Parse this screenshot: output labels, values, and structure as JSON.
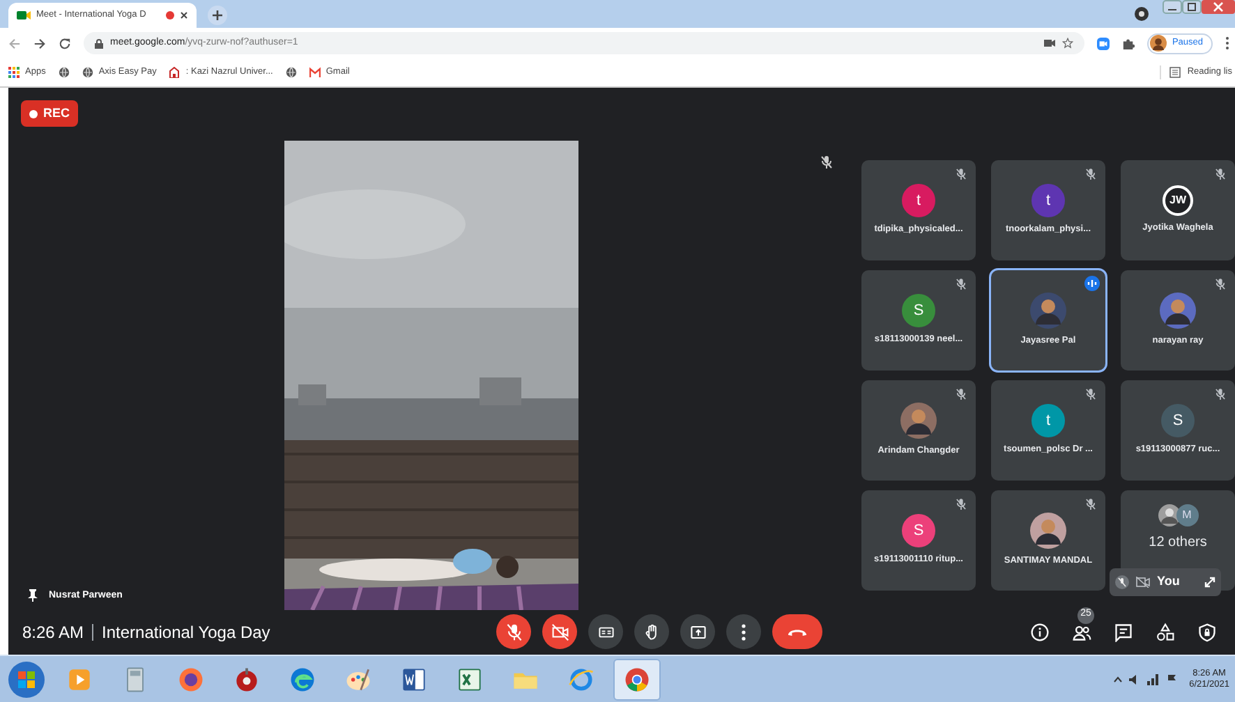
{
  "browser": {
    "tab": {
      "title": "Meet - International Yoga D",
      "recording": true,
      "selected": true
    },
    "url_host": "meet.google.com",
    "url_path": "/yvq-zurw-nof?authuser=1",
    "profile": "Paused",
    "bookmarks": [
      {
        "kind": "apps",
        "label": "Apps"
      },
      {
        "kind": "globe"
      },
      {
        "kind": "globe",
        "label": "Axis Easy Pay"
      },
      {
        "kind": "uni",
        "label": ": Kazi Nazrul Univer..."
      },
      {
        "kind": "globe"
      },
      {
        "kind": "gmail",
        "label": "Gmail"
      }
    ],
    "reading_list": "Reading lis"
  },
  "meet": {
    "rec": "REC",
    "presenter": "Nusrat Parween",
    "presenter_muted": true,
    "tiles": [
      {
        "kind": "letter",
        "name": "tdipika_physicaled...",
        "initial": "t",
        "color": "#d81b60",
        "muted": true,
        "speaking": false
      },
      {
        "kind": "letter",
        "name": "tnoorkalam_physi...",
        "initial": "t",
        "color": "#5e35b1",
        "muted": true,
        "speaking": false
      },
      {
        "kind": "outlined",
        "name": "Jyotika Waghela",
        "initial": "JW",
        "color": "#202124",
        "muted": true,
        "speaking": false
      },
      {
        "kind": "letter",
        "name": "s18113000139 neel...",
        "initial": "S",
        "color": "#388e3c",
        "muted": true,
        "speaking": false
      },
      {
        "name": "Jayasree Pal",
        "color": "#3c4a6e",
        "muted": false,
        "speaking": true
      },
      {
        "name": "narayan ray",
        "color": "#5c6bc0",
        "muted": true,
        "speaking": false
      },
      {
        "name": "Arindam Changder",
        "color": "#8d6e63",
        "muted": true,
        "speaking": false
      },
      {
        "kind": "letter",
        "name": "tsoumen_polsc Dr ...",
        "initial": "t",
        "color": "#0097a7",
        "muted": true,
        "speaking": false
      },
      {
        "kind": "letter",
        "name": "s19113000877 ruc...",
        "initial": "S",
        "color": "#455a64",
        "muted": true,
        "speaking": false
      },
      {
        "kind": "letter",
        "name": "s19113001110 ritup...",
        "initial": "S",
        "color": "#ec407a",
        "muted": true,
        "speaking": false
      },
      {
        "name": "SANTIMAY MANDAL",
        "color": "#c0a0a0",
        "muted": true,
        "speaking": false
      },
      {
        "kind": "others",
        "name": "12 others",
        "initial": "M",
        "color": "#607d8b"
      }
    ],
    "self": {
      "label": "You",
      "muted": true,
      "camera_off": true
    },
    "time": "8:26 AM",
    "meeting": "International Yoga Day",
    "controls": [
      {
        "kind": "mic",
        "off": true
      },
      {
        "kind": "camera",
        "off": true
      },
      {
        "kind": "captions",
        "off": false
      },
      {
        "kind": "hand",
        "off": false
      },
      {
        "kind": "present",
        "off": false
      },
      {
        "kind": "more",
        "off": false
      },
      {
        "kind": "end"
      }
    ],
    "right_controls": [
      {
        "kind": "info"
      },
      {
        "kind": "people",
        "badge": "25"
      },
      {
        "kind": "chat"
      },
      {
        "kind": "activities"
      },
      {
        "kind": "safety"
      }
    ]
  },
  "taskbar": {
    "apps": [
      {
        "kind": "media",
        "selected": false
      },
      {
        "kind": "calc",
        "selected": false
      },
      {
        "kind": "firefox",
        "selected": false
      },
      {
        "kind": "red",
        "selected": false
      },
      {
        "kind": "edge",
        "selected": false
      },
      {
        "kind": "paint",
        "selected": false
      },
      {
        "kind": "word",
        "selected": false
      },
      {
        "kind": "excel",
        "selected": false
      },
      {
        "kind": "folder",
        "selected": false
      },
      {
        "kind": "ie",
        "selected": false
      },
      {
        "kind": "chrome",
        "selected": true
      }
    ],
    "time": "8:26 AM",
    "date": "6/21/2021"
  }
}
